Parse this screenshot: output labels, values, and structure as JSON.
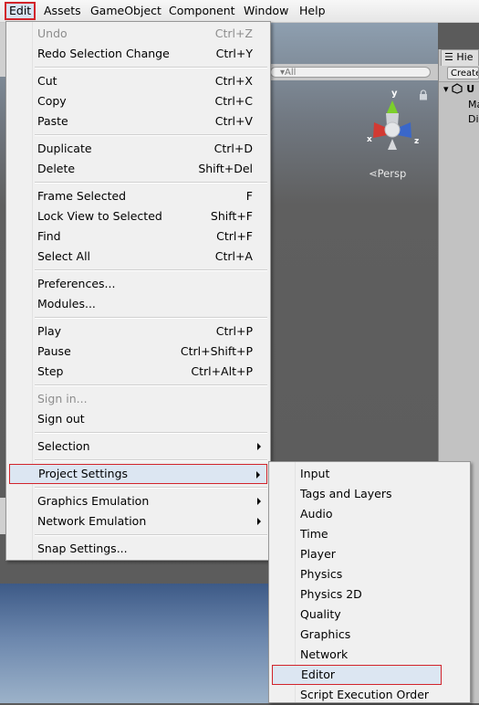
{
  "menubar": {
    "items": [
      "Edit",
      "Assets",
      "GameObject",
      "Component",
      "Window",
      "Help"
    ],
    "active": "Edit"
  },
  "scene": {
    "search_placeholder": "All",
    "gizmo_axes": {
      "y": "y",
      "x": "x",
      "z": "z"
    },
    "projection_label": "Persp"
  },
  "hierarchy": {
    "tab": "Hie",
    "create_button": "Create",
    "rows": [
      "U",
      "Ma",
      "Di"
    ]
  },
  "edit_menu": {
    "groups": [
      [
        {
          "label": "Undo",
          "shortcut": "Ctrl+Z",
          "disabled": true
        },
        {
          "label": "Redo Selection Change",
          "shortcut": "Ctrl+Y"
        }
      ],
      [
        {
          "label": "Cut",
          "shortcut": "Ctrl+X"
        },
        {
          "label": "Copy",
          "shortcut": "Ctrl+C"
        },
        {
          "label": "Paste",
          "shortcut": "Ctrl+V"
        }
      ],
      [
        {
          "label": "Duplicate",
          "shortcut": "Ctrl+D"
        },
        {
          "label": "Delete",
          "shortcut": "Shift+Del"
        }
      ],
      [
        {
          "label": "Frame Selected",
          "shortcut": "F"
        },
        {
          "label": "Lock View to Selected",
          "shortcut": "Shift+F"
        },
        {
          "label": "Find",
          "shortcut": "Ctrl+F"
        },
        {
          "label": "Select All",
          "shortcut": "Ctrl+A"
        }
      ],
      [
        {
          "label": "Preferences..."
        },
        {
          "label": "Modules..."
        }
      ],
      [
        {
          "label": "Play",
          "shortcut": "Ctrl+P"
        },
        {
          "label": "Pause",
          "shortcut": "Ctrl+Shift+P"
        },
        {
          "label": "Step",
          "shortcut": "Ctrl+Alt+P"
        }
      ],
      [
        {
          "label": "Sign in...",
          "disabled": true
        },
        {
          "label": "Sign out"
        }
      ],
      [
        {
          "label": "Selection",
          "submenu": true
        }
      ],
      [
        {
          "label": "Project Settings",
          "submenu": true,
          "highlighted": true
        }
      ],
      [
        {
          "label": "Graphics Emulation",
          "submenu": true
        },
        {
          "label": "Network Emulation",
          "submenu": true
        }
      ],
      [
        {
          "label": "Snap Settings..."
        }
      ]
    ]
  },
  "project_settings_menu": {
    "items": [
      "Input",
      "Tags and Layers",
      "Audio",
      "Time",
      "Player",
      "Physics",
      "Physics 2D",
      "Quality",
      "Graphics",
      "Network",
      "Editor",
      "Script Execution Order"
    ],
    "highlighted": "Editor"
  },
  "colors": {
    "highlight_border": "#d2242b",
    "highlight_fill": "#dce6f2",
    "menu_bg": "#f0f0f0",
    "gizmo_y": "#7ccf2b",
    "gizmo_x": "#d23a33",
    "gizmo_z": "#3a67c9"
  }
}
